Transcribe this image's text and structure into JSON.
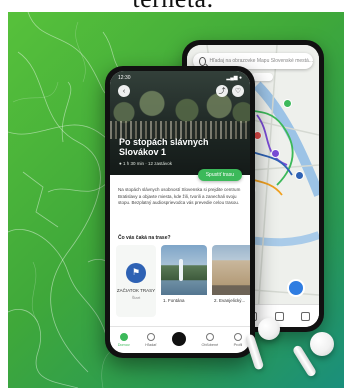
{
  "heading": {
    "text": "terneta."
  },
  "map_phone": {
    "search_placeholder": "Hľadaj na obrazovke Mapu Slovenské mestá..."
  },
  "detail_phone": {
    "status_time": "12:30",
    "status_icons": "▂▄▆ ●",
    "title": "Po stopách slávnych Slovákov 1",
    "meta": "● 1 h 30 min · 12 zastávok",
    "cta": "Spustiť trasu",
    "description": "Na stopách slávnych osobností Slovenska si prejdite centrum Bratislavy a objavte miesta, kde žili, tvorili a zanechali svoju stopu. Bezplatný audiosprievodca vás prevedie celou trasou.",
    "section_title": "Čo vás čaká na trase?",
    "start_card": {
      "label": "ZAČIATOK TRASY",
      "sub": "Štart"
    },
    "cards": [
      {
        "caption": "1. Fontána"
      },
      {
        "caption": "2. Evanjelický..."
      }
    ],
    "nav": [
      {
        "label": "Domov",
        "active": true
      },
      {
        "label": "Hľadať",
        "active": false
      },
      {
        "label": "",
        "active": false
      },
      {
        "label": "Obľúbené",
        "active": false
      },
      {
        "label": "Profil",
        "active": false
      }
    ]
  },
  "colors": {
    "promo_green": "#3fa83a",
    "accent_green": "#3cb95a",
    "start_blue": "#2e62b4"
  }
}
